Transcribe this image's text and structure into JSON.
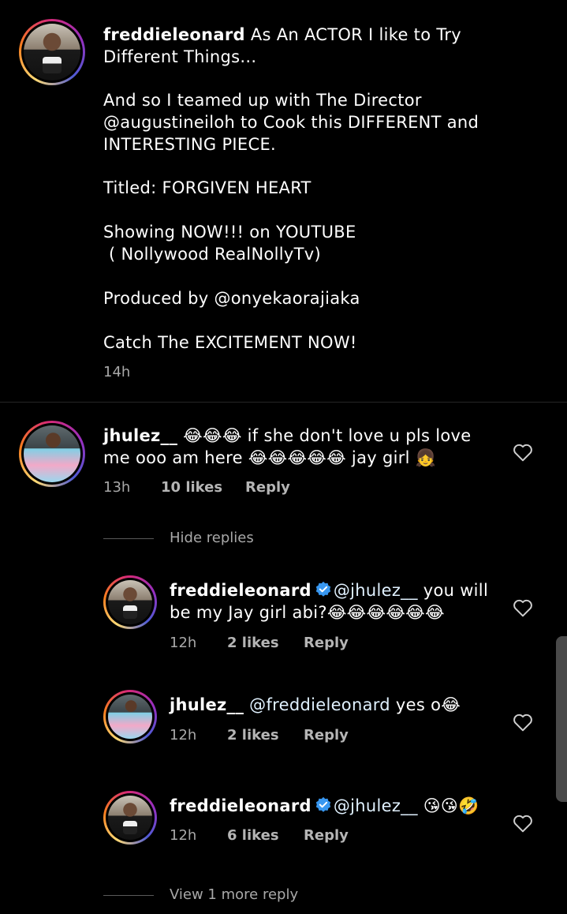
{
  "caption": {
    "username": "freddieleonard",
    "lines": [
      "As An ACTOR I like to Try",
      "Different Things...",
      "",
      "And so I teamed up with The Director",
      "@augustineiloh to Cook this DIFFERENT and",
      "INTERESTING PIECE.",
      "",
      "Titled: FORGIVEN HEART",
      "",
      "Showing NOW!!! on YOUTUBE",
      " ( Nollywood RealNollyTv)",
      "",
      "Produced by @onyekaorajiaka",
      "",
      "Catch The EXCITEMENT NOW!"
    ],
    "time": "14h"
  },
  "comments": [
    {
      "username": "jhulez__",
      "text_line1": "😂😂😂 if she don't love u pls love",
      "text_line2": "me ooo am here 😂😂😂😂😂 jay girl 👧",
      "time": "13h",
      "likes": "10 likes",
      "reply_label": "Reply",
      "hide_replies": "Hide replies"
    }
  ],
  "replies": [
    {
      "username": "freddieleonard",
      "verified": true,
      "mention": "@jhulez__",
      "text_line1": " you will",
      "text_line2": "be my Jay girl abi?😂😂😂😂😂😂",
      "time": "12h",
      "likes": "2 likes",
      "reply_label": "Reply"
    },
    {
      "username": "jhulez__",
      "verified": false,
      "mention": "@freddieleonard",
      "text_line1": " yes o😂",
      "time": "12h",
      "likes": "2 likes",
      "reply_label": "Reply"
    },
    {
      "username": "freddieleonard",
      "verified": true,
      "mention": "@jhulez__",
      "text_line1": " 😘😘🤣",
      "time": "12h",
      "likes": "6 likes",
      "reply_label": "Reply"
    }
  ],
  "view_more": "View 1 more reply",
  "colors": {
    "background": "#000000",
    "text": "#ffffff",
    "meta": "#a8a8a8",
    "verified": "#3897f0"
  },
  "icons": [
    "heart-outline-icon",
    "verified-badge-icon"
  ]
}
